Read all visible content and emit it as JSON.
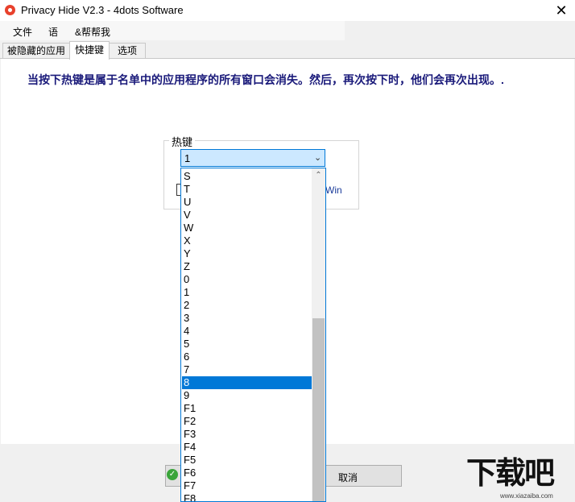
{
  "window": {
    "title": "Privacy Hide V2.3 - 4dots Software",
    "close_glyph": "✕"
  },
  "menu": {
    "items": [
      "文件",
      "语",
      "&帮帮我"
    ]
  },
  "tabs": [
    {
      "label": "被隐藏的应用"
    },
    {
      "label": "快捷键",
      "active": true
    },
    {
      "label": "选项"
    }
  ],
  "description": "当按下热键是属于名单中的应用程序的所有窗口会消失。然后，再次按下时，他们会再次出现。.",
  "hotkey": {
    "group_label": "热键",
    "selected_value": "1",
    "win_label": "Win"
  },
  "dropdown": {
    "options": [
      "S",
      "T",
      "U",
      "V",
      "W",
      "X",
      "Y",
      "Z",
      "0",
      "1",
      "2",
      "3",
      "4",
      "5",
      "6",
      "7",
      "8",
      "9",
      "F1",
      "F2",
      "F3",
      "F4",
      "F5",
      "F6",
      "F7",
      "F8"
    ],
    "highlighted": "8"
  },
  "buttons": {
    "cancel_label": "取消"
  },
  "watermark": {
    "text": "下载吧",
    "url": "www.xiazaiba.com"
  },
  "colors": {
    "accent": "#0078d7",
    "description_text": "#1a1a7a",
    "ok_icon": "#3aa53a"
  },
  "icons": {
    "app": "lifebuoy-icon",
    "close": "close-icon",
    "combo_arrow": "chevron-down-icon",
    "scroll_up": "chevron-up-icon",
    "ok": "check-circle-icon"
  }
}
